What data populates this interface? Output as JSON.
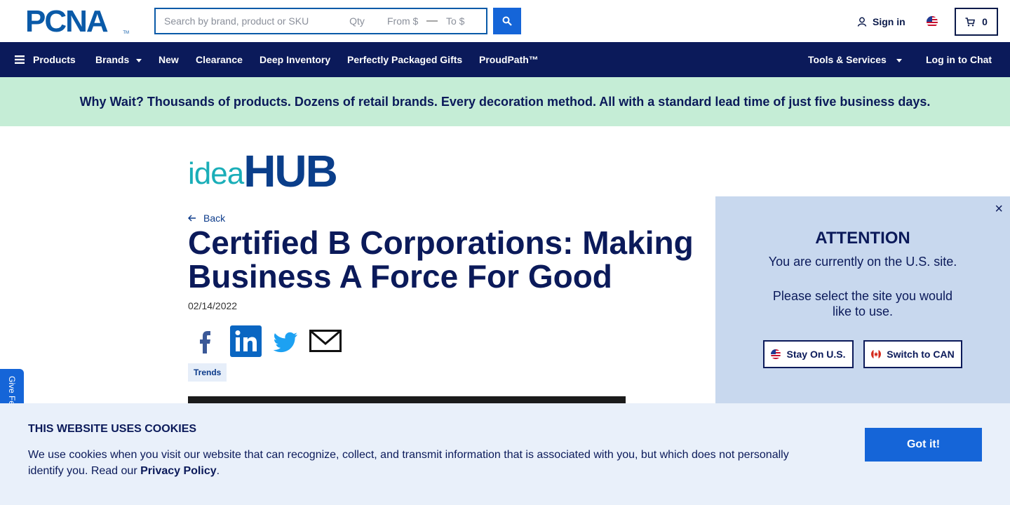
{
  "header": {
    "logo": "PCNA",
    "logo_tm": "TM",
    "search_placeholder": "Search by brand, product or SKU",
    "qty_placeholder": "Qty",
    "from_placeholder": "From $",
    "to_placeholder": "To $",
    "signin_label": "Sign in",
    "cart_count": "0"
  },
  "nav": {
    "products": "Products",
    "brands": "Brands",
    "new": "New",
    "clearance": "Clearance",
    "deep_inventory": "Deep Inventory",
    "gifts": "Perfectly Packaged Gifts",
    "proudpath": "ProudPath™",
    "tools": "Tools & Services",
    "chat": "Log in to Chat"
  },
  "banner": {
    "text": "Why Wait? Thousands of products. Dozens of retail brands. Every decoration method. All with a standard lead time of just five business days."
  },
  "article": {
    "brand_idea": "idea",
    "brand_hub": "HUB",
    "back_label": "Back",
    "title": "Certified B Corporations: Making Business A Force For Good",
    "date": "02/14/2022",
    "tag": "Trends"
  },
  "feedback": {
    "label": "Give Feedback"
  },
  "attention": {
    "title": "ATTENTION",
    "line1": "You are currently on the U.S. site.",
    "line2": "Please select the site you would like to use.",
    "stay_label": "Stay On U.S.",
    "switch_label": "Switch to CAN",
    "close": "×"
  },
  "cookies": {
    "title": "THIS WEBSITE USES COOKIES",
    "body": "We use cookies when you visit our website that can recognize, collect, and transmit information that is associated with you, but which does not personally identify you. Read our ",
    "policy_link": "Privacy Policy",
    "period": ".",
    "button": "Got it!"
  },
  "colors": {
    "navy": "#0b1a5a",
    "brand_blue": "#1565d8",
    "banner_green": "#c5edd6",
    "popup_bg": "#c8d8ee",
    "cookie_bg": "#e9f0fa"
  },
  "icons": {
    "search": "search-icon",
    "user": "user-icon",
    "cart": "cart-icon",
    "menu": "hamburger-icon",
    "back": "arrow-left-icon",
    "close": "close-icon"
  }
}
